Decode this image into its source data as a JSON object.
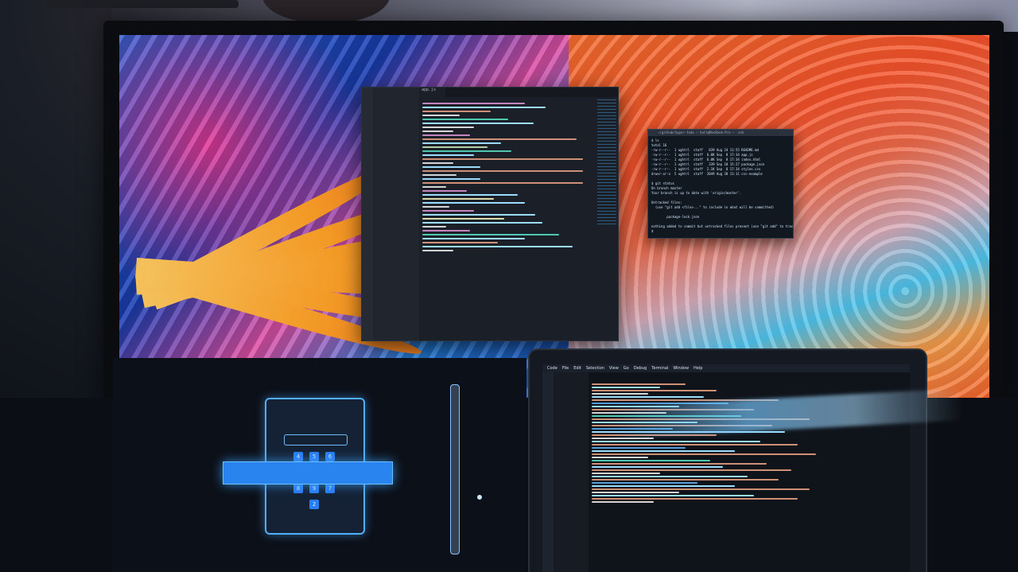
{
  "scene": {
    "description_colors": {
      "left_wallpaper_accent": "#f39a26",
      "right_wallpaper_accent": "#f0602a",
      "ui_glow": "#2a84f0"
    }
  },
  "monitor": {
    "editor_tab": "app.js",
    "terminal": {
      "title": "~/github/hyper-todo — hatl@MacBook-Pro — -zsh",
      "lines": [
        "$ ls",
        "total 16",
        "-rw-r--r--  1 ughtrl  staff   839 Aug 24 11:55 README.md",
        "-rw-r--r--  1 ughtrl  staff  6.0K Sep  8 17:34 app.js",
        "-rw-r--r--  1 ughtrl  staff  6.0K Sep  8 17:34 index.html",
        "-rw-r--r--  1 ughtrl  staff   339 Sep 10 15:27 package.json",
        "-rw-r--r--  1 ughtrl  staff  2.1K Sep  8 17:34 styles.css",
        "drwxr-xr-x  5 ughtrl  staff  2049 Aug 28 11:11 css-example",
        "",
        "$ git status",
        "On branch master",
        "Your branch is up to date with 'origin/master'.",
        "",
        "Untracked files:",
        "  (use \"git add <file>...\" to include in what will be committed)",
        "",
        "        package-lock.json",
        "",
        "nothing added to commit but untracked files present (use \"git add\" to track)",
        "$"
      ]
    }
  },
  "tablet": {
    "keys": [
      "4",
      "5",
      "6",
      "8",
      "9",
      "7",
      "2"
    ]
  },
  "laptop": {
    "menu": [
      "Code",
      "File",
      "Edit",
      "Selection",
      "View",
      "Go",
      "Debug",
      "Terminal",
      "Window",
      "Help"
    ]
  }
}
